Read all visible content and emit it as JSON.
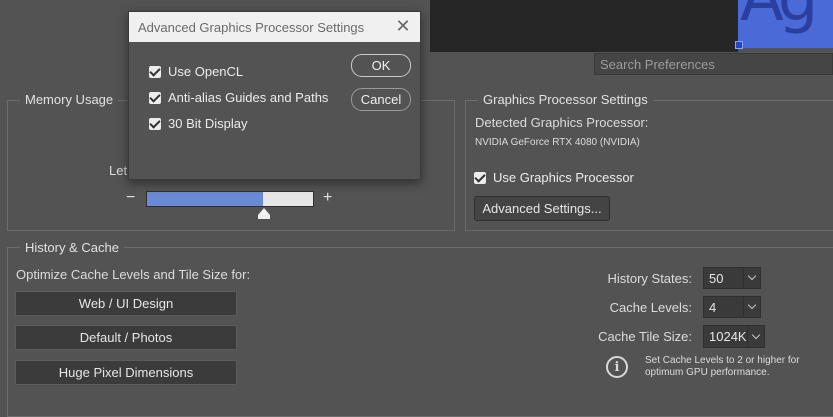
{
  "dialog": {
    "title": "Advanced Graphics Processor Settings",
    "close_icon": "close-icon",
    "options": [
      {
        "label": "Use OpenCL",
        "checked": true
      },
      {
        "label": "Anti-alias Guides and Paths",
        "checked": true
      },
      {
        "label": "30 Bit Display",
        "checked": true
      }
    ],
    "ok_label": "OK",
    "cancel_label": "Cancel"
  },
  "search": {
    "placeholder": "Search Preferences"
  },
  "canvas_preview": {
    "glyph": "Ag"
  },
  "memory": {
    "title": "Memory Usage",
    "partial_label": "Let",
    "minus": "−",
    "plus": "+",
    "slider_fraction": 0.7
  },
  "gpu": {
    "title": "Graphics Processor Settings",
    "detected_label": "Detected Graphics Processor:",
    "device": "NVIDIA GeForce RTX 4080 (NVIDIA)",
    "use_gpu_label": "Use Graphics Processor",
    "use_gpu_checked": true,
    "advanced_button": "Advanced Settings..."
  },
  "history": {
    "title": "History & Cache",
    "optimize_label": "Optimize Cache Levels and Tile Size for:",
    "buttons": [
      "Web / UI Design",
      "Default / Photos",
      "Huge Pixel Dimensions"
    ],
    "history_states_label": "History States:",
    "history_states_value": "50",
    "cache_levels_label": "Cache Levels:",
    "cache_levels_value": "4",
    "tile_size_label": "Cache Tile Size:",
    "tile_size_value": "1024K",
    "info_text_1": "Set Cache Levels to 2 or higher for",
    "info_text_2": "optimum GPU performance.",
    "info_icon": "info-icon"
  },
  "colors": {
    "panel": "#535353",
    "slider_fill": "#6a8ad6",
    "canvas_blue": "#4a6ad8"
  }
}
